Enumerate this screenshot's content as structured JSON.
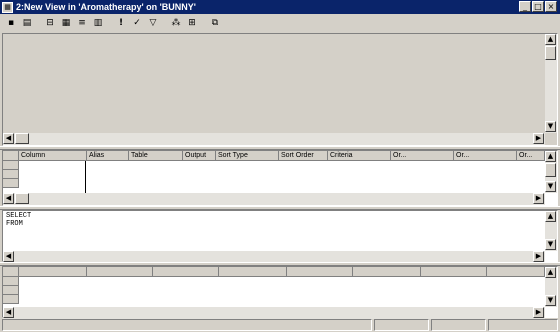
{
  "window": {
    "title": "2:New View in 'Aromatherapy' on 'BUNNY'",
    "controls": [
      "_",
      "□",
      "×"
    ]
  },
  "toolbar": {
    "buttons": [
      "save-icon",
      "print-icon",
      "show-diagram-icon",
      "show-grid-icon",
      "show-sql-icon",
      "show-results-icon",
      "run-icon",
      "verify-sql-icon",
      "remove-filter-icon",
      "group-by-icon",
      "add-table-icon",
      "new-view-icon"
    ]
  },
  "grid": {
    "columns": [
      "Column",
      "Alias",
      "Table",
      "Output",
      "Sort Type",
      "Sort Order",
      "Criteria",
      "Or...",
      "Or...",
      "Or..."
    ]
  },
  "sql": {
    "line1": "SELECT",
    "line2": "FROM"
  }
}
